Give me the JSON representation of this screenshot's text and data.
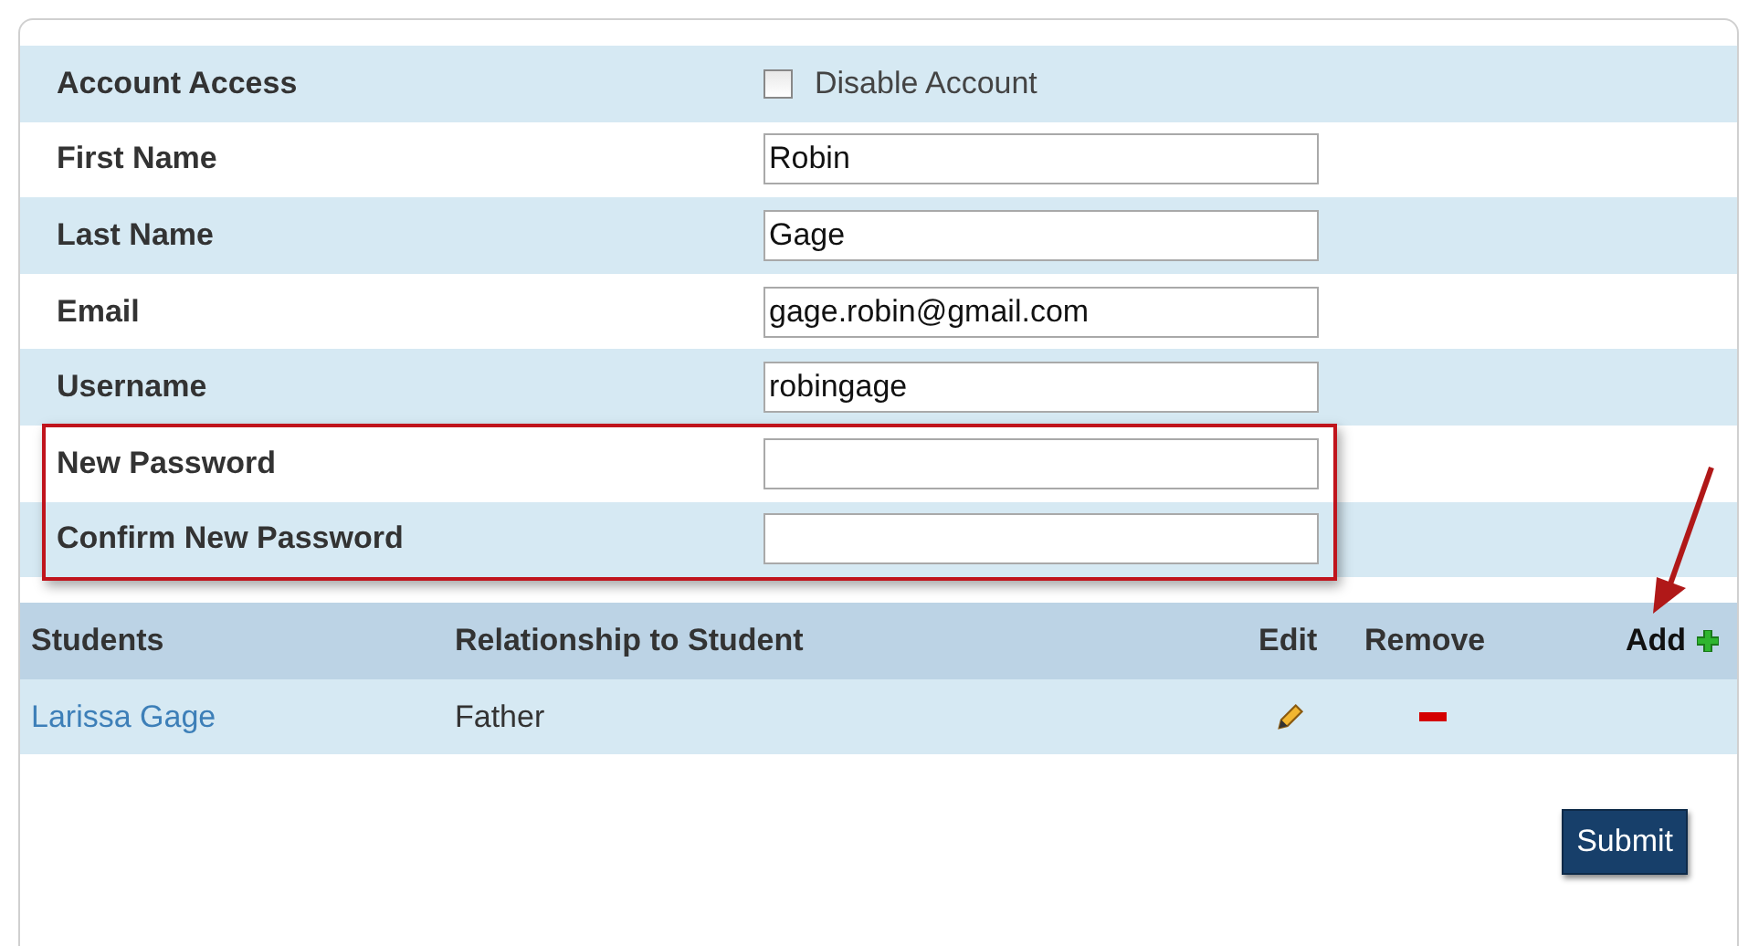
{
  "account_form": {
    "rows": [
      {
        "kind": "checkbox",
        "label": "Account Access",
        "option": "Disable Account",
        "checked": false
      },
      {
        "kind": "text",
        "label": "First Name",
        "value": "Robin"
      },
      {
        "kind": "text",
        "label": "Last Name",
        "value": "Gage"
      },
      {
        "kind": "text",
        "label": "Email",
        "value": "gage.robin@gmail.com"
      },
      {
        "kind": "text",
        "label": "Username",
        "value": "robingage"
      },
      {
        "kind": "password",
        "label": "New Password",
        "value": ""
      },
      {
        "kind": "password",
        "label": "Confirm New Password",
        "value": ""
      }
    ]
  },
  "students": {
    "columns": [
      "Students",
      "Relationship to Student",
      "Edit",
      "Remove",
      "Add"
    ],
    "rows": [
      {
        "name": "Larissa Gage",
        "relationship": "Father"
      }
    ]
  },
  "submit": "Submit"
}
